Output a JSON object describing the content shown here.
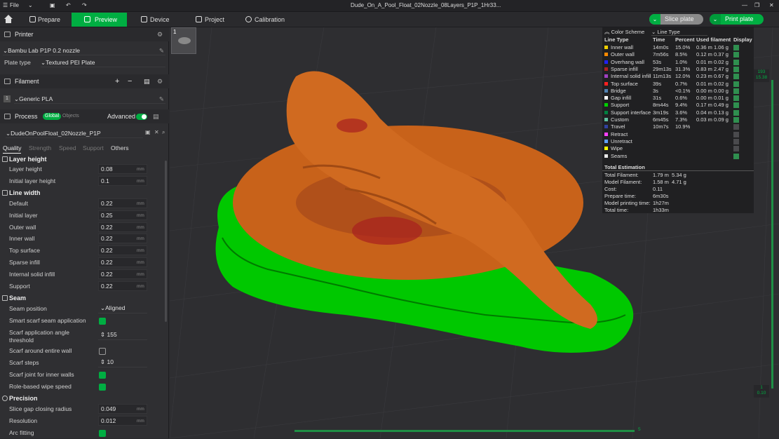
{
  "titlebar": {
    "file_label": "File",
    "title": "Dude_On_A_Pool_Float_02Nozzle_08Layers_P1P_1Hr33..."
  },
  "tabs": [
    {
      "label": "Prepare"
    },
    {
      "label": "Preview"
    },
    {
      "label": "Device"
    },
    {
      "label": "Project"
    },
    {
      "label": "Calibration"
    }
  ],
  "actions": {
    "slice": "Slice plate",
    "print": "Print plate"
  },
  "printer": {
    "section": "Printer",
    "name": "Bambu Lab P1P 0.2 nozzle",
    "plate_type_label": "Plate type",
    "plate_type": "Textured PEI Plate"
  },
  "filament": {
    "section": "Filament",
    "slot": "1",
    "name": "Generic PLA"
  },
  "process": {
    "section": "Process",
    "global": "Global",
    "objects": "Objects",
    "advanced": "Advanced",
    "profile": "DudeOnPoolFloat_02Nozzle_P1P"
  },
  "subtabs": [
    "Quality",
    "Strength",
    "Speed",
    "Support",
    "Others"
  ],
  "groups": {
    "layer_height": "Layer height",
    "line_width": "Line width",
    "seam": "Seam",
    "precision": "Precision"
  },
  "settings": {
    "layer_height": {
      "label": "Layer height",
      "value": "0.08",
      "unit": "mm"
    },
    "initial_layer_height": {
      "label": "Initial layer height",
      "value": "0.1",
      "unit": "mm"
    },
    "lw_default": {
      "label": "Default",
      "value": "0.22",
      "unit": "mm"
    },
    "lw_initial": {
      "label": "Initial layer",
      "value": "0.25",
      "unit": "mm"
    },
    "lw_outer": {
      "label": "Outer wall",
      "value": "0.22",
      "unit": "mm"
    },
    "lw_inner": {
      "label": "Inner wall",
      "value": "0.22",
      "unit": "mm"
    },
    "lw_top": {
      "label": "Top surface",
      "value": "0.22",
      "unit": "mm"
    },
    "lw_sparse": {
      "label": "Sparse infill",
      "value": "0.22",
      "unit": "mm"
    },
    "lw_internal": {
      "label": "Internal solid infill",
      "value": "0.22",
      "unit": "mm"
    },
    "lw_support": {
      "label": "Support",
      "value": "0.22",
      "unit": "mm"
    },
    "seam_position": {
      "label": "Seam position",
      "value": "Aligned"
    },
    "smart_scarf": {
      "label": "Smart scarf seam application",
      "checked": true
    },
    "scarf_angle": {
      "label1": "Scarf application angle",
      "label2": "threshold",
      "value": "155"
    },
    "scarf_around": {
      "label": "Scarf around entire wall",
      "checked": false
    },
    "scarf_steps": {
      "label": "Scarf steps",
      "value": "10"
    },
    "scarf_joint": {
      "label": "Scarf joint for inner walls",
      "checked": true
    },
    "role_wipe": {
      "label": "Role-based wipe speed",
      "checked": true
    },
    "slice_gap": {
      "label": "Slice gap closing radius",
      "value": "0.049",
      "unit": "mm"
    },
    "resolution": {
      "label": "Resolution",
      "value": "0.012",
      "unit": "mm"
    },
    "arc_fitting": {
      "label": "Arc fitting",
      "checked": true
    }
  },
  "legend": {
    "title": "Color Scheme",
    "scheme": "Line Type",
    "headers": [
      "Line Type",
      "Time",
      "Percent",
      "Used filament",
      "Display"
    ],
    "rows": [
      {
        "name": "Inner wall",
        "time": "14m0s",
        "pct": "15.0%",
        "used": "0.36 m 1.06 g",
        "color": "#f0d000",
        "on": true
      },
      {
        "name": "Outer wall",
        "time": "7m56s",
        "pct": "8.5%",
        "used": "0.12 m 0.37 g",
        "color": "#ff8a00",
        "on": true
      },
      {
        "name": "Overhang wall",
        "time": "53s",
        "pct": "1.0%",
        "used": "0.01 m 0.02 g",
        "color": "#2020ff",
        "on": true
      },
      {
        "name": "Sparse infill",
        "time": "29m13s",
        "pct": "31.3%",
        "used": "0.83 m 2.47 g",
        "color": "#b02020",
        "on": true
      },
      {
        "name": "Internal solid infill",
        "time": "11m13s",
        "pct": "12.0%",
        "used": "0.23 m 0.67 g",
        "color": "#a040c0",
        "on": true
      },
      {
        "name": "Top surface",
        "time": "39s",
        "pct": "0.7%",
        "used": "0.01 m 0.02 g",
        "color": "#ff2020",
        "on": true
      },
      {
        "name": "Bridge",
        "time": "3s",
        "pct": "<0.1%",
        "used": "0.00 m 0.00 g",
        "color": "#5080b0",
        "on": true
      },
      {
        "name": "Gap infill",
        "time": "31s",
        "pct": "0.6%",
        "used": "0.00 m 0.01 g",
        "color": "#ffffff",
        "on": true
      },
      {
        "name": "Support",
        "time": "8m44s",
        "pct": "9.4%",
        "used": "0.17 m 0.49 g",
        "color": "#00d000",
        "on": true
      },
      {
        "name": "Support interface",
        "time": "3m19s",
        "pct": "3.6%",
        "used": "0.04 m 0.13 g",
        "color": "#008040",
        "on": true
      },
      {
        "name": "Custom",
        "time": "6m45s",
        "pct": "7.3%",
        "used": "0.03 m 0.09 g",
        "color": "#60c0a0",
        "on": true
      },
      {
        "name": "Travel",
        "time": "10m7s",
        "pct": "10.9%",
        "used": "",
        "color": "#3040a0",
        "on": false
      },
      {
        "name": "Retract",
        "time": "",
        "pct": "",
        "used": "",
        "color": "#ff40ff",
        "on": false
      },
      {
        "name": "Unretract",
        "time": "",
        "pct": "",
        "used": "",
        "color": "#60a0ff",
        "on": false
      },
      {
        "name": "Wipe",
        "time": "",
        "pct": "",
        "used": "",
        "color": "#ffff00",
        "on": false
      },
      {
        "name": "Seams",
        "time": "",
        "pct": "",
        "used": "",
        "color": "#e8e8e8",
        "on": true
      }
    ],
    "estimation_title": "Total Estimation",
    "estimation": [
      {
        "k": "Total Filament:",
        "v": "1.79 m",
        "v2": "5.34 g"
      },
      {
        "k": "Model Filament:",
        "v": "1.58 m",
        "v2": "4.71 g"
      },
      {
        "k": "Cost:",
        "v": "0.11",
        "v2": ""
      },
      {
        "k": "Prepare time:",
        "v": "6m30s",
        "v2": ""
      },
      {
        "k": "Model printing time:",
        "v": "1h27m",
        "v2": ""
      },
      {
        "k": "Total time:",
        "v": "1h33m",
        "v2": ""
      }
    ]
  },
  "plate": {
    "number": "1"
  },
  "layer_slider": {
    "top": "193",
    "top_height": "15.38",
    "bottom": "1",
    "bottom_height": "0.10"
  },
  "move_slider": {
    "value": "5"
  }
}
